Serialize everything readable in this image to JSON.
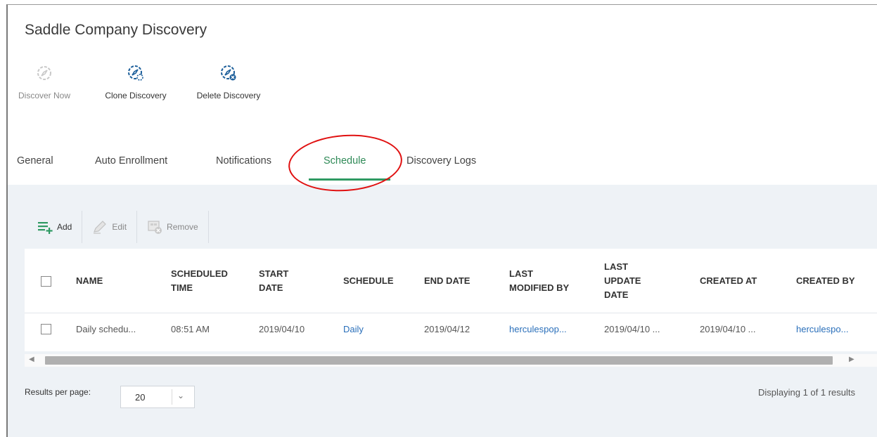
{
  "page": {
    "title": "Saddle Company Discovery"
  },
  "toolbar": {
    "discover_now": {
      "label": "Discover Now",
      "icon": "discover-now-icon"
    },
    "clone_discovery": {
      "label": "Clone Discovery",
      "icon": "clone-discovery-icon"
    },
    "delete_discovery": {
      "label": "Delete Discovery",
      "icon": "delete-discovery-icon"
    }
  },
  "tabs": [
    {
      "label": "General"
    },
    {
      "label": "Auto Enrollment"
    },
    {
      "label": "Notifications"
    },
    {
      "label": "Schedule",
      "active": true
    },
    {
      "label": "Discovery Logs"
    }
  ],
  "actions": {
    "add": "Add",
    "edit": "Edit",
    "remove": "Remove"
  },
  "table": {
    "columns": [
      {
        "line1": "NAME",
        "line2": "",
        "line3": ""
      },
      {
        "line1": "SCHEDULED",
        "line2": "TIME",
        "line3": ""
      },
      {
        "line1": "START",
        "line2": "DATE",
        "line3": ""
      },
      {
        "line1": "SCHEDULE",
        "line2": "",
        "line3": ""
      },
      {
        "line1": "END DATE",
        "line2": "",
        "line3": ""
      },
      {
        "line1": "LAST",
        "line2": "MODIFIED BY",
        "line3": ""
      },
      {
        "line1": "LAST",
        "line2": "UPDATE",
        "line3": "DATE"
      },
      {
        "line1": "CREATED AT",
        "line2": "",
        "line3": ""
      },
      {
        "line1": "CREATED BY",
        "line2": "",
        "line3": ""
      }
    ],
    "rows": [
      {
        "name": "Daily schedu...",
        "scheduled_time": "08:51 AM",
        "start_date": "2019/04/10",
        "schedule": "Daily",
        "end_date": "2019/04/12",
        "last_modified_by": "herculespop...",
        "last_update_date": "2019/04/10 ...",
        "created_at": "2019/04/10 ...",
        "created_by": "herculespo..."
      }
    ]
  },
  "pagination": {
    "results_per_page_label": "Results per page:",
    "results_per_page_value": "20",
    "displaying": "Displaying 1 of 1 results"
  },
  "colors": {
    "accent": "#2f9a63",
    "link": "#2a6fba",
    "highlight": "#e01010"
  }
}
